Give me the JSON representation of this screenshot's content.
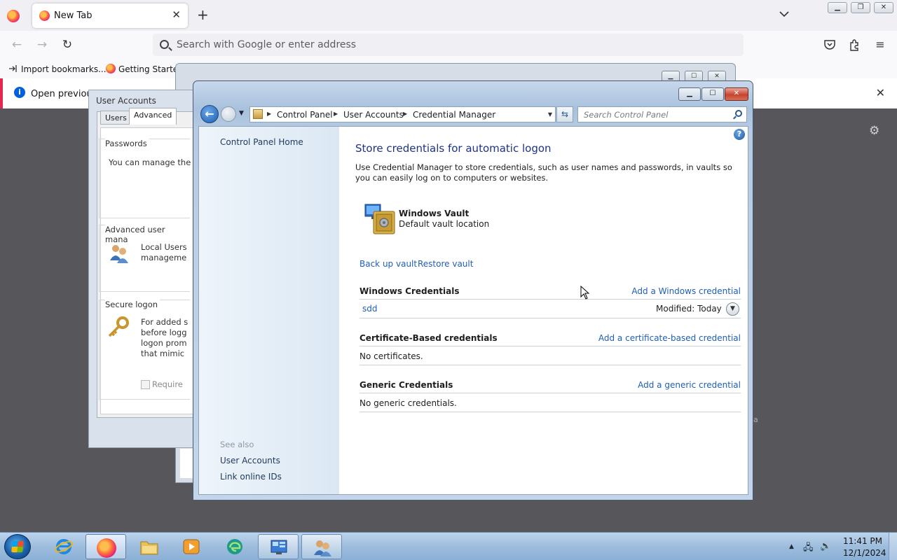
{
  "firefox": {
    "tab_title": "New Tab",
    "url_placeholder": "Search with Google or enter address",
    "bookmarks": [
      "Import bookmarks...",
      "Getting Started"
    ],
    "notification": "Open previous"
  },
  "user_accounts": {
    "title": "User Accounts",
    "tabs": [
      "Users",
      "Advanced"
    ],
    "passwords_label": "Passwords",
    "passwords_text": "You can manage the",
    "advanced_label": "Advanced user mana",
    "advanced_text": "Local Users\nmanageme",
    "secure_label": "Secure logon",
    "secure_text": "For added s\nbefore logg\nlogon prom\nthat mimic",
    "require_label": "Require"
  },
  "credential_manager": {
    "breadcrumb": [
      "Control Panel",
      "User Accounts",
      "Credential Manager"
    ],
    "search_placeholder": "Search Control Panel",
    "left_nav": {
      "home": "Control Panel Home",
      "see_also": "See also",
      "links": [
        "User Accounts",
        "Link online IDs"
      ]
    },
    "title": "Store credentials for automatic logon",
    "description": "Use Credential Manager to store credentials, such as user names and passwords, in vaults so you can easily log on to computers or websites.",
    "vault": {
      "name": "Windows Vault",
      "location": "Default vault location"
    },
    "backup_link": "Back up vault",
    "restore_link": "Restore vault",
    "sections": [
      {
        "heading": "Windows Credentials",
        "add_link": "Add a Windows credential",
        "item": "sdd",
        "modified": "Modified:  Today"
      },
      {
        "heading": "Certificate-Based credentials",
        "add_link": "Add a certificate-based credential",
        "empty": "No certificates."
      },
      {
        "heading": "Generic Credentials",
        "add_link": "Add a generic credential",
        "empty": "No generic credentials."
      }
    ]
  },
  "taskbar": {
    "apps": [
      "internet-explorer",
      "firefox",
      "file-explorer",
      "media-player",
      "edge-browser",
      "control-panel",
      "user-accounts"
    ],
    "time": "11:41 PM",
    "date": "12/1/2024"
  }
}
